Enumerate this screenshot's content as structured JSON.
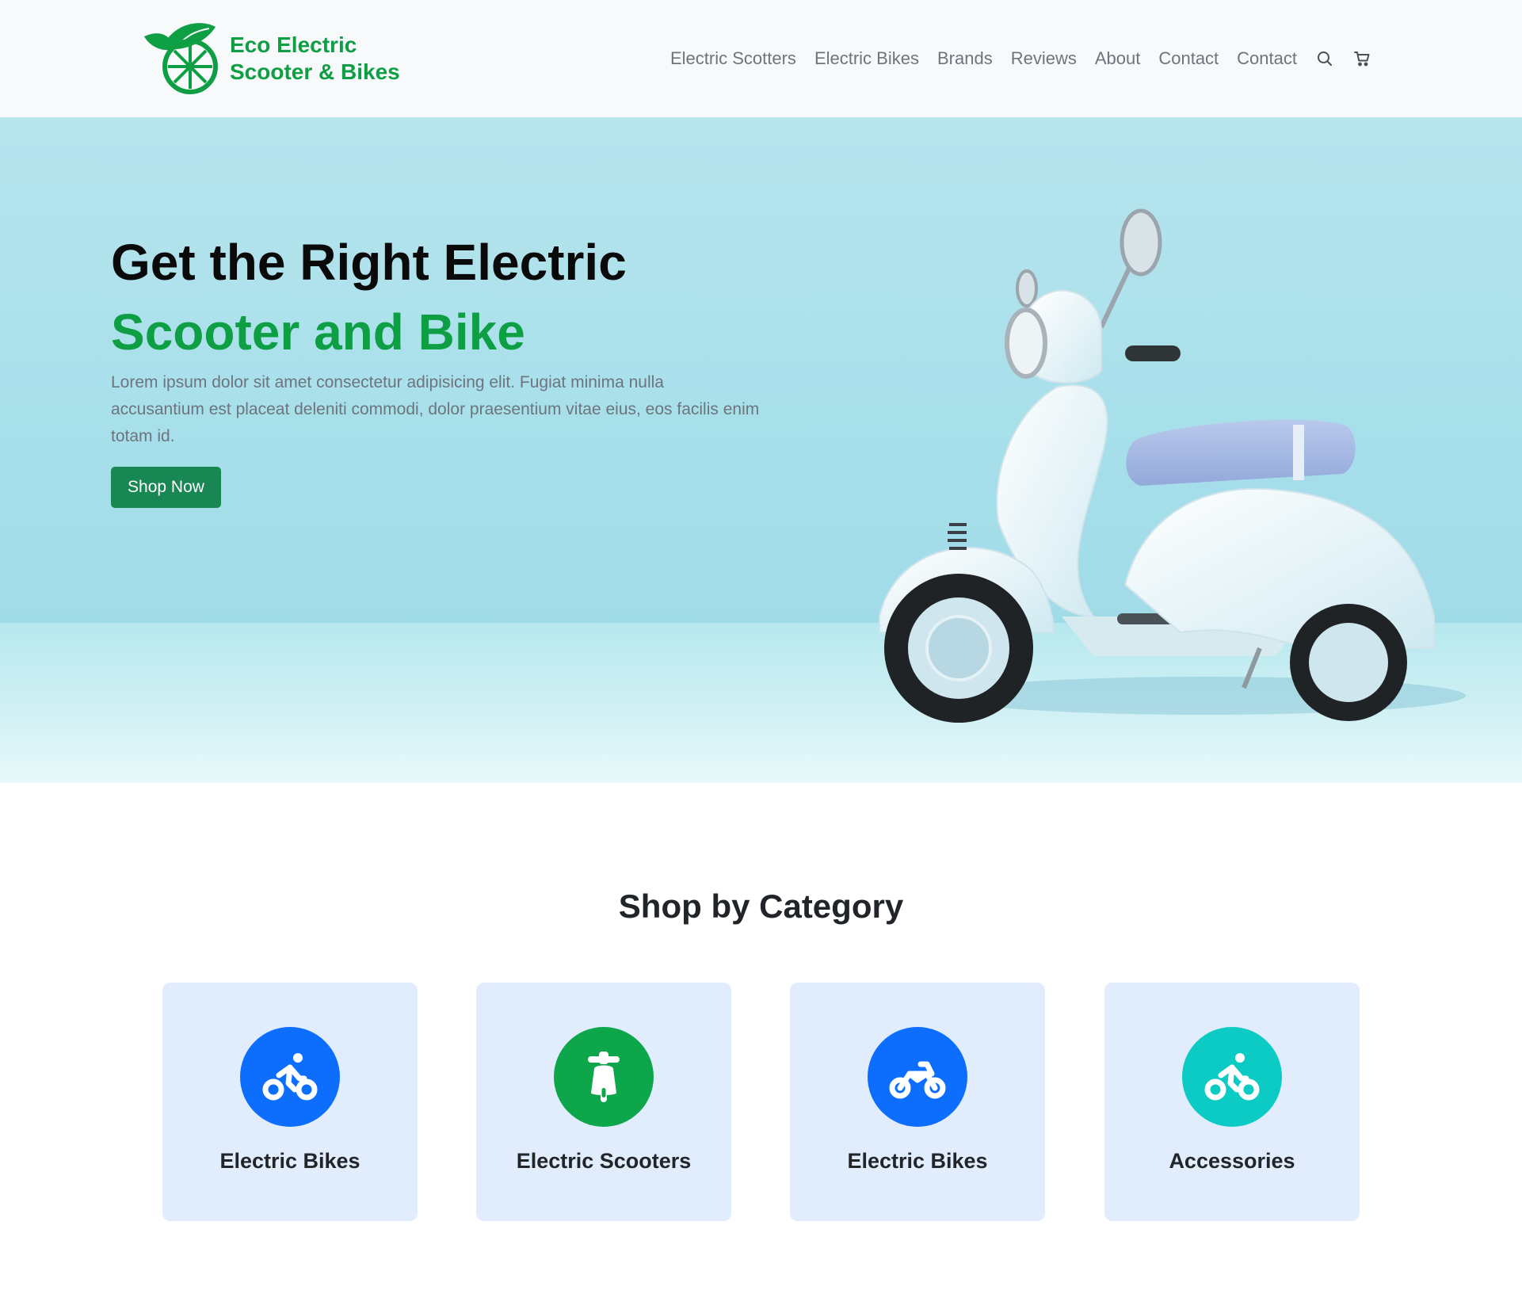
{
  "brand": {
    "line1": "Eco Electric",
    "line2": "Scooter & Bikes",
    "logo_icon": "leaf-wheel-logo-icon",
    "color": "#0e9f45"
  },
  "nav": {
    "items": [
      "Electric Scotters",
      "Electric Bikes",
      "Brands",
      "Reviews",
      "About",
      "Contact",
      "Contact"
    ],
    "search_icon": "search-icon",
    "cart_icon": "cart-icon"
  },
  "hero": {
    "title_line1": "Get the Right Electric",
    "title_line2": "Scooter and Bike",
    "description": "Lorem ipsum dolor sit amet consectetur adipisicing elit. Fugiat minima nulla accusantium est placeat deleniti commodi, dolor praesentium vitae eius, eos facilis enim totam id.",
    "cta_label": "Shop Now",
    "accent_color": "#0e9f45",
    "button_color": "#198754"
  },
  "categories": {
    "title": "Shop by Category",
    "items": [
      {
        "label": "Electric Bikes",
        "icon": "bicycle-rider-icon",
        "color": "#0d6efd"
      },
      {
        "label": "Electric Scooters",
        "icon": "scooter-icon",
        "color": "#0ea64b"
      },
      {
        "label": "Electric Bikes",
        "icon": "motorbike-icon",
        "color": "#0d6efd"
      },
      {
        "label": "Accessories",
        "icon": "bicycle-rider-icon",
        "color": "#0ccac4"
      }
    ]
  }
}
